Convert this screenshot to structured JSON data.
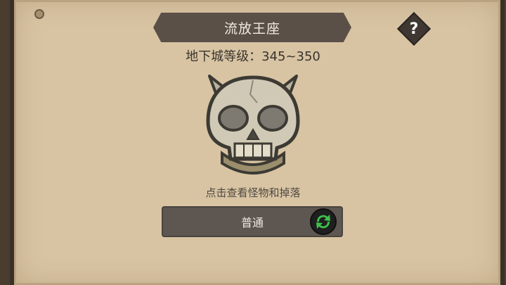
{
  "header": {
    "title": "流放王座",
    "help_symbol": "?"
  },
  "dungeon": {
    "level_text": "地下城等级：345~350",
    "boss_icon": "horned-skull-icon"
  },
  "hint_text": "点击查看怪物和掉落",
  "mode": {
    "label": "普通",
    "switch_icon": "refresh-arrows-icon"
  },
  "colors": {
    "panel": "#d8c4a3",
    "title_bar": "#5b5048",
    "refresh_green": "#39b54a"
  }
}
